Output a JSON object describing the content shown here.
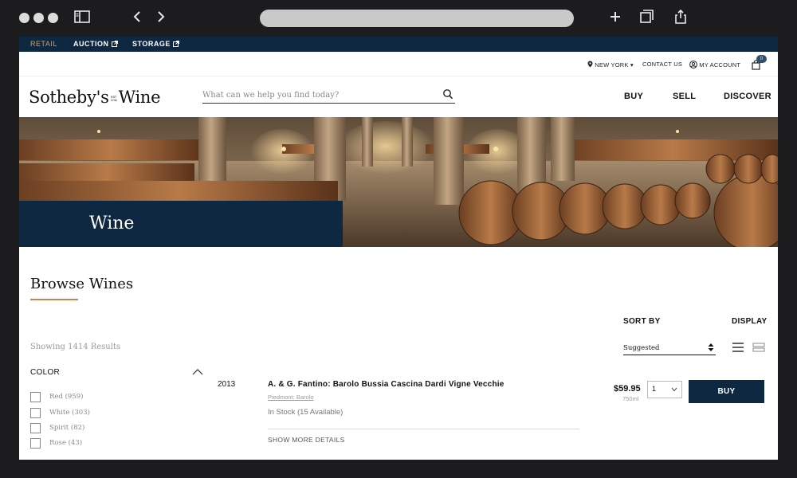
{
  "top_nav": {
    "retail": "RETAIL",
    "auction": "AUCTION",
    "storage": "STORAGE"
  },
  "utility": {
    "location": "NEW YORK",
    "contact": "CONTACT US",
    "account": "MY ACCOUNT",
    "cart_count": "0"
  },
  "header": {
    "logo_left": "Sotheby's",
    "logo_small_1": "EST",
    "logo_small_2": "1744",
    "logo_right": "Wine",
    "search_placeholder": "What can we help you find today?",
    "nav": [
      "BUY",
      "SELL",
      "DISCOVER"
    ]
  },
  "hero": {
    "title": "Wine"
  },
  "browse": {
    "title": "Browse Wines",
    "results_text": "Showing 1414 Results"
  },
  "filters": {
    "heading": "COLOR",
    "options": [
      {
        "label": "Red (959)"
      },
      {
        "label": "White (303)"
      },
      {
        "label": "Spirit (82)"
      },
      {
        "label": "Rose (43)"
      }
    ]
  },
  "sort": {
    "label": "SORT BY",
    "value": "Suggested"
  },
  "display": {
    "label": "DISPLAY"
  },
  "product": {
    "year": "2013",
    "name": "A. & G. Fantino: Barolo Bussia Cascina Dardi Vigne Vecchie",
    "region": "Piedmont: Barolo",
    "stock": "In Stock (15 Available)",
    "more_details": "SHOW MORE DETAILS",
    "price": "$59.95",
    "volume": "750ml",
    "quantity": "1",
    "buy_label": "BUY"
  },
  "colors": {
    "navy": "#0f2842",
    "accent": "#c9a26b"
  }
}
